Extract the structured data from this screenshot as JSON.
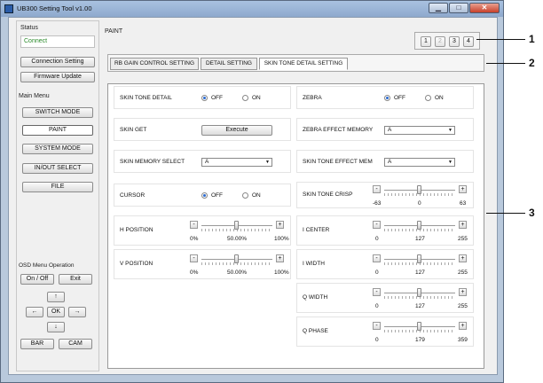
{
  "window": {
    "title": "UB300 Setting Tool v1.00"
  },
  "sidebar": {
    "status_label": "Status",
    "status_value": "Connect",
    "connection_setting": "Connection Setting",
    "firmware_update": "Firmware Update",
    "main_menu_label": "Main Menu",
    "menu_items": [
      "SWITCH MODE",
      "PAINT",
      "SYSTEM MODE",
      "IN/OUT SELECT",
      "FILE"
    ],
    "osd_label": "OSD Menu Operation",
    "osd_on_off": "On / Off",
    "osd_exit": "Exit",
    "osd_up": "↑",
    "osd_left": "←",
    "osd_ok": "OK",
    "osd_right": "→",
    "osd_down": "↓",
    "osd_bar": "BAR",
    "osd_cam": "CAM"
  },
  "main": {
    "title": "PAINT",
    "page_buttons": [
      "1",
      "2",
      "3",
      "4"
    ],
    "tabs": [
      "RB GAIN CONTROL SETTING",
      "DETAIL SETTING",
      "SKIN TONE DETAIL SETTING"
    ],
    "left_rows": {
      "skin_tone_detail": {
        "label": "SKIN TONE DETAIL",
        "off": "OFF",
        "on": "ON"
      },
      "skin_get": {
        "label": "SKIN GET",
        "button": "Execute"
      },
      "skin_memory_select": {
        "label": "SKIN MEMORY SELECT",
        "value": "A"
      },
      "cursor": {
        "label": "CURSOR",
        "off": "OFF",
        "on": "ON"
      },
      "h_position": {
        "label": "H POSITION",
        "min": "0%",
        "mid": "50.00%",
        "max": "100%",
        "value": 50
      },
      "v_position": {
        "label": "V POSITION",
        "min": "0%",
        "mid": "50.00%",
        "max": "100%",
        "value": 50
      }
    },
    "right_rows": {
      "zebra": {
        "label": "ZEBRA",
        "off": "OFF",
        "on": "ON"
      },
      "zebra_effect_memory": {
        "label": "ZEBRA EFFECT MEMORY",
        "value": "A"
      },
      "skin_tone_effect_mem": {
        "label": "SKIN TONE  EFFECT MEM",
        "value": "A"
      },
      "skin_tone_crisp": {
        "label": "SKIN TONE CRISP",
        "min": "-63",
        "mid": "0",
        "max": "63"
      },
      "i_center": {
        "label": "I CENTER",
        "min": "0",
        "mid": "127",
        "max": "255"
      },
      "i_width": {
        "label": "I WIDTH",
        "min": "0",
        "mid": "127",
        "max": "255"
      },
      "q_width": {
        "label": "Q WIDTH",
        "min": "0",
        "mid": "127",
        "max": "255"
      },
      "q_phase": {
        "label": "Q PHASE",
        "min": "0",
        "mid": "179",
        "max": "359"
      }
    },
    "minus": "-",
    "plus": "+"
  },
  "callouts": [
    "1",
    "2",
    "3"
  ]
}
